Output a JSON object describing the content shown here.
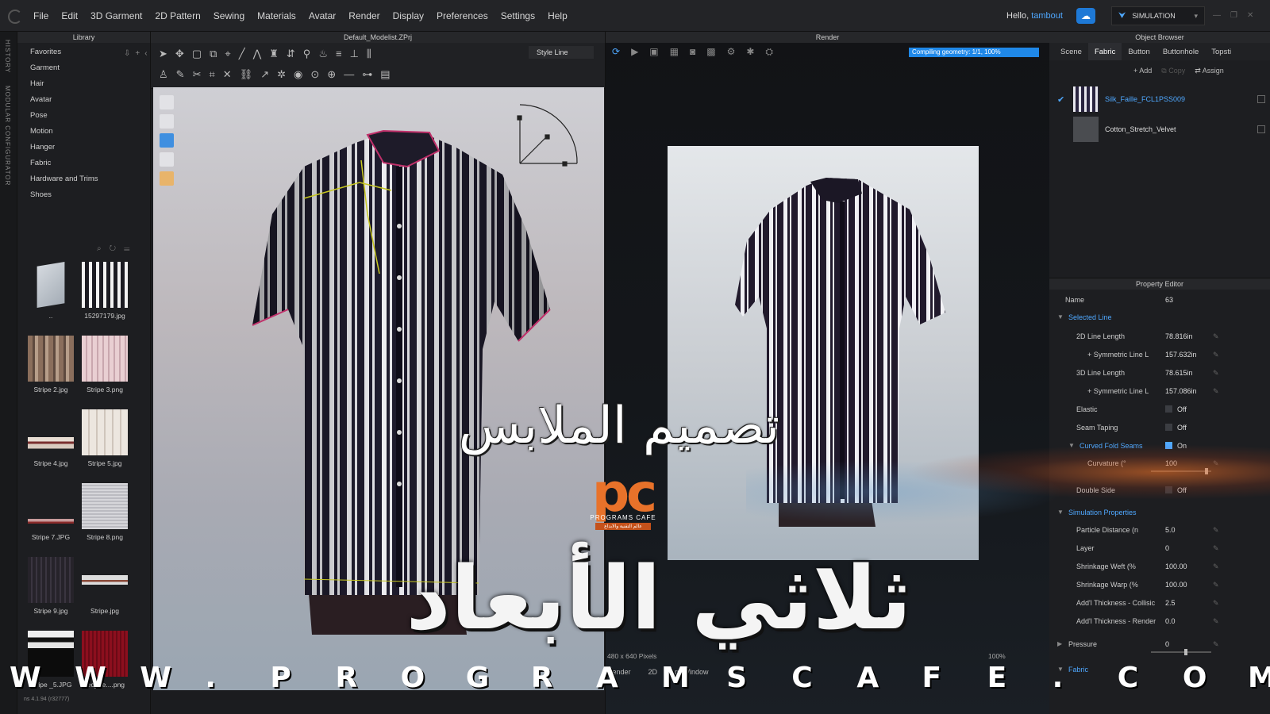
{
  "menubar": {
    "items": [
      "File",
      "Edit",
      "3D Garment",
      "2D Pattern",
      "Sewing",
      "Materials",
      "Avatar",
      "Render",
      "Display",
      "Preferences",
      "Settings",
      "Help"
    ],
    "hello": "Hello,",
    "user": "tambout",
    "sim_label": "SIMULATION"
  },
  "sidestrip": {
    "history": "HISTORY",
    "modular": "MODULAR CONFIGURATOR"
  },
  "library": {
    "title": "Library",
    "nav": [
      "Favorites",
      "Garment",
      "Hair",
      "Avatar",
      "Pose",
      "Motion",
      "Hanger",
      "Fabric",
      "Hardware and Trims",
      "Shoes"
    ],
    "thumbs": [
      {
        "cap": "..",
        "kind": "folder"
      },
      {
        "cap": "15297179.jpg",
        "kind": "stripe-bw"
      },
      {
        "cap": "Stripe 2.jpg",
        "kind": "stripe-brown"
      },
      {
        "cap": "Stripe 3.png",
        "kind": "stripe-pink"
      },
      {
        "cap": "Stripe 4.jpg",
        "kind": "stripe-thin"
      },
      {
        "cap": "Stripe 5.jpg",
        "kind": "stripe-light"
      },
      {
        "cap": "Stripe 7.JPG",
        "kind": "stripe-red"
      },
      {
        "cap": "Stripe 8.png",
        "kind": "stripe-grid"
      },
      {
        "cap": "Stripe 9.jpg",
        "kind": "stripe-dark"
      },
      {
        "cap": "Stripe.jpg",
        "kind": "stripe-thin2"
      },
      {
        "cap": "Stripe _5.JPG",
        "kind": "stripe-black"
      },
      {
        "cap": "red_be....png",
        "kind": "stripe-redvel"
      }
    ]
  },
  "viewport": {
    "title": "Default_Modelist.ZPrj",
    "style_line": "Style Line"
  },
  "render": {
    "title": "Render",
    "progress": "Compiling geometry: 1/1, 100%",
    "progress_value": 1.0,
    "size": "480 x 640 Pixels",
    "zoom": "100%",
    "tab_render": "Render",
    "tab_2d": "2D",
    "tab_window": "rn Window"
  },
  "object_browser": {
    "title": "Object Browser",
    "tabs": [
      "Scene",
      "Fabric",
      "Button",
      "Buttonhole",
      "Topsti"
    ],
    "active_tab": "Fabric",
    "add": "Add",
    "copy": "Copy",
    "assign": "Assign",
    "fabrics": [
      {
        "name": "Silk_Faille_FCL1PSS009",
        "selected": true
      },
      {
        "name": "Cotton_Stretch_Velvet",
        "selected": false
      }
    ]
  },
  "property_editor": {
    "title": "Property Editor",
    "name_label": "Name",
    "name_value": "63",
    "rows": [
      {
        "label": "Selected Line",
        "section": true,
        "indent": 0,
        "value": ""
      },
      {
        "label": "2D Line Length",
        "indent": 1,
        "value": "78.816in"
      },
      {
        "label": "+ Symmetric Line L",
        "indent": 2,
        "value": "157.632in"
      },
      {
        "label": "3D Line Length",
        "indent": 1,
        "value": "78.615in"
      },
      {
        "label": "+ Symmetric Line L",
        "indent": 2,
        "value": "157.086in"
      },
      {
        "label": "Elastic",
        "indent": 1,
        "value": "Off",
        "check": true
      },
      {
        "label": "Seam Taping",
        "indent": 1,
        "value": "Off",
        "check": true
      },
      {
        "label": "Curved Fold Seams",
        "section": true,
        "indent": 1,
        "value": "On",
        "check": true
      },
      {
        "label": "Curvature (°",
        "indent": 2,
        "value": "100",
        "slider": 0.9
      },
      {
        "label": "Double Side",
        "indent": 1,
        "value": "Off",
        "check": true
      },
      {
        "label": "Simulation Properties",
        "section": true,
        "indent": 0,
        "value": ""
      },
      {
        "label": "Particle Distance (n",
        "indent": 1,
        "value": "5.0"
      },
      {
        "label": "Layer",
        "indent": 1,
        "value": "0"
      },
      {
        "label": "Shrinkage Weft (%",
        "indent": 1,
        "value": "100.00"
      },
      {
        "label": "Shrinkage Warp (%",
        "indent": 1,
        "value": "100.00"
      },
      {
        "label": "Add'l Thickness - Collisic",
        "indent": 1,
        "value": "2.5"
      },
      {
        "label": "Add'l Thickness - Render",
        "indent": 1,
        "value": "0.0"
      },
      {
        "label": "Pressure",
        "indent": 0,
        "value": "0",
        "slider": 0.55
      },
      {
        "label": "Fabric",
        "section": true,
        "indent": 0,
        "value": ""
      }
    ]
  },
  "overlay": {
    "arabic_line1": "تصميم الملابس",
    "arabic_line2": "ثلاثي الأبعاد",
    "logo_pc": "pc",
    "logo_name": "PROGRAMS CAFE",
    "logo_sub": "عالم التقنية والابداع",
    "watermark": [
      "W",
      "W",
      "W",
      ".",
      "P",
      "R",
      "O",
      "G",
      "R",
      "A",
      "M",
      "S",
      "C",
      "A",
      "F",
      "E",
      ".",
      "C",
      "O",
      "M"
    ],
    "version": "ns 4.1.94 (r32777)"
  },
  "colors": {
    "accent": "#4fa8ff",
    "progress": "#1f88e8",
    "logo": "#e8722a"
  }
}
